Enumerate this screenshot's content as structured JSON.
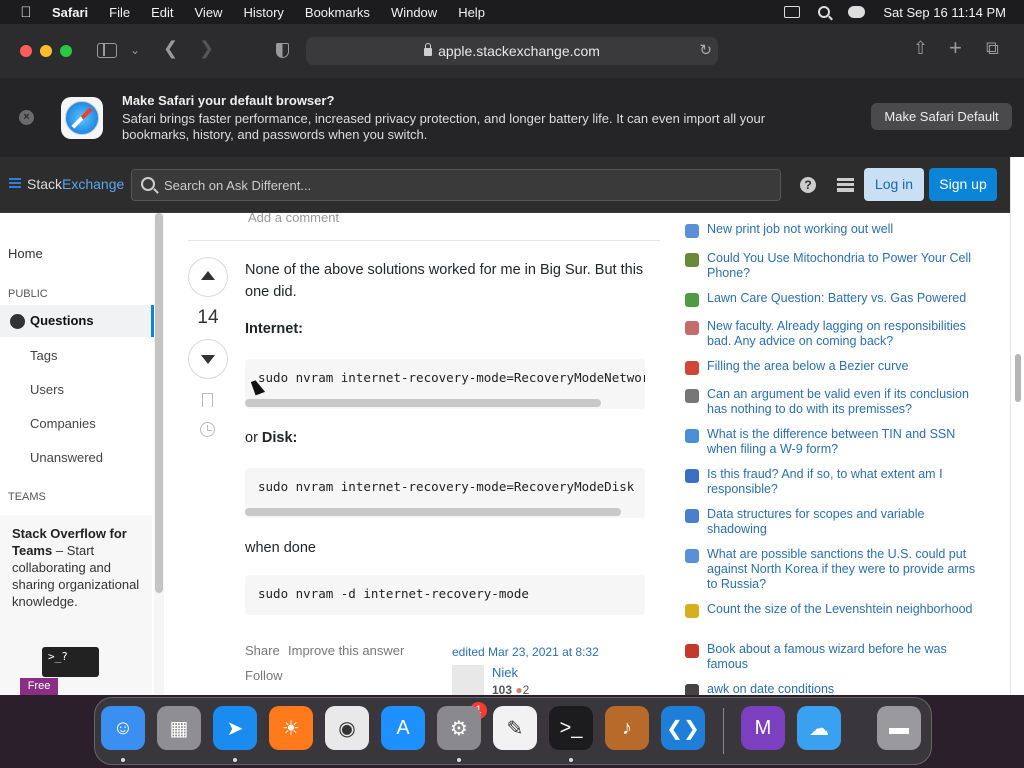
{
  "menubar": {
    "app_name": "Safari",
    "menus": [
      "File",
      "Edit",
      "View",
      "History",
      "Bookmarks",
      "Window",
      "Help"
    ],
    "datetime": "Sat Sep 16  11:14 PM"
  },
  "toolbar": {
    "url": "apple.stackexchange.com"
  },
  "banner": {
    "title": "Make Safari your default browser?",
    "text": "Safari brings faster performance, increased privacy protection, and longer battery life. It can even import all your bookmarks, history, and passwords when you switch.",
    "button": "Make Safari Default"
  },
  "se": {
    "logo_stack": "Stack",
    "logo_exchange": "Exchange",
    "search_placeholder": "Search on Ask Different...",
    "login": "Log in",
    "signup": "Sign up"
  },
  "nav": {
    "home": "Home",
    "public_label": "PUBLIC",
    "questions": "Questions",
    "tags": "Tags",
    "users": "Users",
    "companies": "Companies",
    "unanswered": "Unanswered",
    "teams_label": "TEAMS",
    "teams_title": "Stack Overflow for Teams",
    "teams_text": " – Start collaborating and sharing organizational knowledge.",
    "free_badge": "Free",
    "terminal_prompt": ">_?"
  },
  "answer": {
    "add_comment": "Add a comment",
    "votes": "14",
    "intro": "None of the above solutions worked for me in Big Sur. But this one did.",
    "internet_label": "Internet:",
    "code_internet": "sudo nvram internet-recovery-mode=RecoveryModeNetwork",
    "or_text": "or ",
    "disk_label": "Disk:",
    "code_disk": "sudo nvram internet-recovery-mode=RecoveryModeDisk",
    "when_done": "when done",
    "code_done": "sudo nvram -d internet-recovery-mode",
    "share": "Share",
    "improve": "Improve this answer",
    "follow": "Follow",
    "edited": "edited Mar 23, 2021 at 8:32",
    "user_name": "Niek",
    "user_rep": "103",
    "user_badges": "2"
  },
  "hnq": [
    {
      "title": "New print job not working out well",
      "color": "#5b8fd6"
    },
    {
      "title": "Could You Use Mitochondria to Power Your Cell Phone?",
      "color": "#6a8a3a"
    },
    {
      "title": "Lawn Care Question: Battery vs. Gas Powered",
      "color": "#4f9a42"
    },
    {
      "title": "New faculty. Already lagging on responsibilities bad. Any advice on coming back?",
      "color": "#c46b6b"
    },
    {
      "title": "Filling the area below a Bezier curve",
      "color": "#d0463b"
    },
    {
      "title": "Can an argument be valid even if its conclusion has nothing to do with its premisses?",
      "color": "#777777"
    },
    {
      "title": "What is the difference between TIN and SSN when filing a W-9 form?",
      "color": "#4a90d9"
    },
    {
      "title": "Is this fraud? And if so, to what extent am I responsible?",
      "color": "#3b6fc4"
    },
    {
      "title": "Data structures for scopes and variable shadowing",
      "color": "#4a7fd0"
    },
    {
      "title": "What are possible sanctions the U.S. could put against North Korea if they were to provide arms to Russia?",
      "color": "#5b8fd6"
    },
    {
      "title": "Count the size of the Levenshtein neighborhood",
      "color": "#d4b020"
    },
    {
      "title": "Book about a famous wizard before he was famous",
      "color": "#c0392b"
    },
    {
      "title": "awk on date conditions",
      "color": "#444444"
    }
  ],
  "dock": {
    "apps": [
      "finder-icon",
      "launchpad-icon",
      "safari-icon",
      "firefox-icon",
      "chrome-icon",
      "app-store-icon",
      "system-settings-icon",
      "textedit-icon",
      "terminal-icon",
      "instruments-icon",
      "vscode-icon",
      "visual-studio-icon",
      "weather-icon",
      "trash-icon"
    ],
    "settings_badge": "1"
  }
}
